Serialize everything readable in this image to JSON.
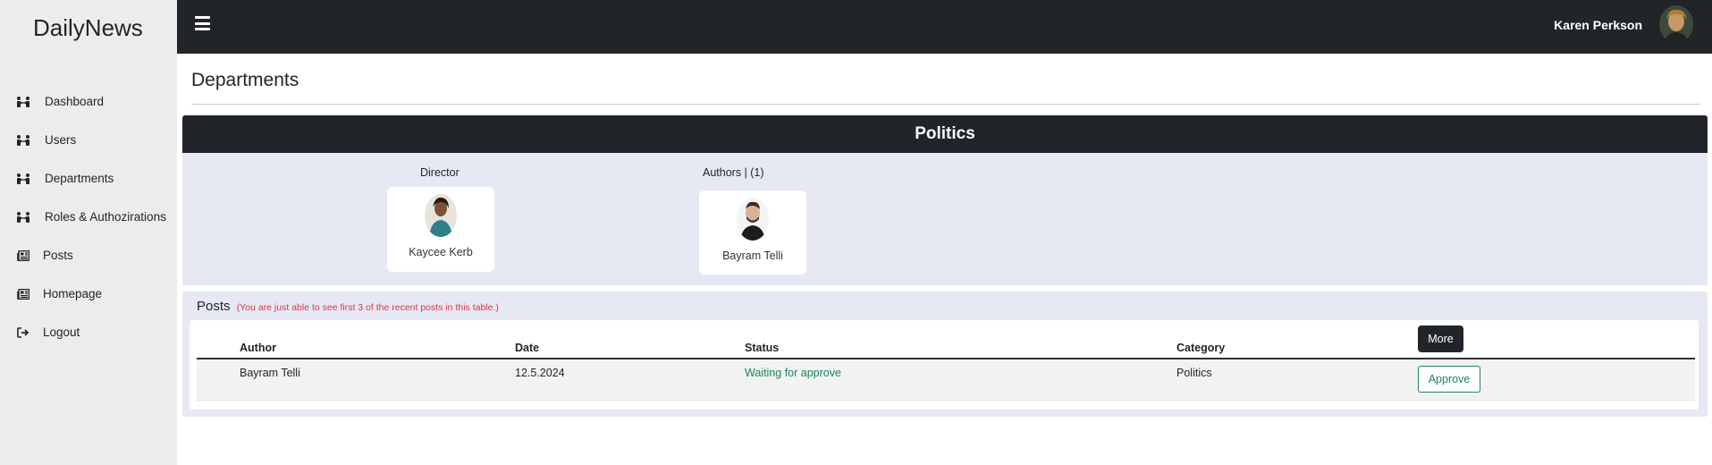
{
  "brand": "DailyNews",
  "sidebar": {
    "items": [
      {
        "label": "Dashboard"
      },
      {
        "label": "Users"
      },
      {
        "label": "Departments"
      },
      {
        "label": "Roles & Authozirations"
      },
      {
        "label": "Posts"
      },
      {
        "label": "Homepage"
      },
      {
        "label": "Logout"
      }
    ]
  },
  "topbar": {
    "username": "Karen Perkson"
  },
  "page": {
    "title": "Departments"
  },
  "department": {
    "name": "Politics",
    "director_label": "Director",
    "director_name": "Kaycee Kerb",
    "authors_label": "Authors | (1)",
    "authors": [
      {
        "name": "Bayram Telli"
      }
    ]
  },
  "posts": {
    "title": "Posts",
    "note": "(You are just able to see first 3 of the recent posts in this table.)",
    "columns": [
      "Author",
      "Date",
      "Status",
      "Category"
    ],
    "more_label": "More",
    "rows": [
      {
        "author": "Bayram Telli",
        "date": "12.5.2024",
        "status": "Waiting for approve",
        "category": "Politics",
        "action": "Approve"
      }
    ]
  },
  "colors": {
    "dark": "#212529",
    "panel": "#e6e8f4",
    "success": "#198754",
    "danger": "#dc3545",
    "sidebar": "#ececec"
  }
}
